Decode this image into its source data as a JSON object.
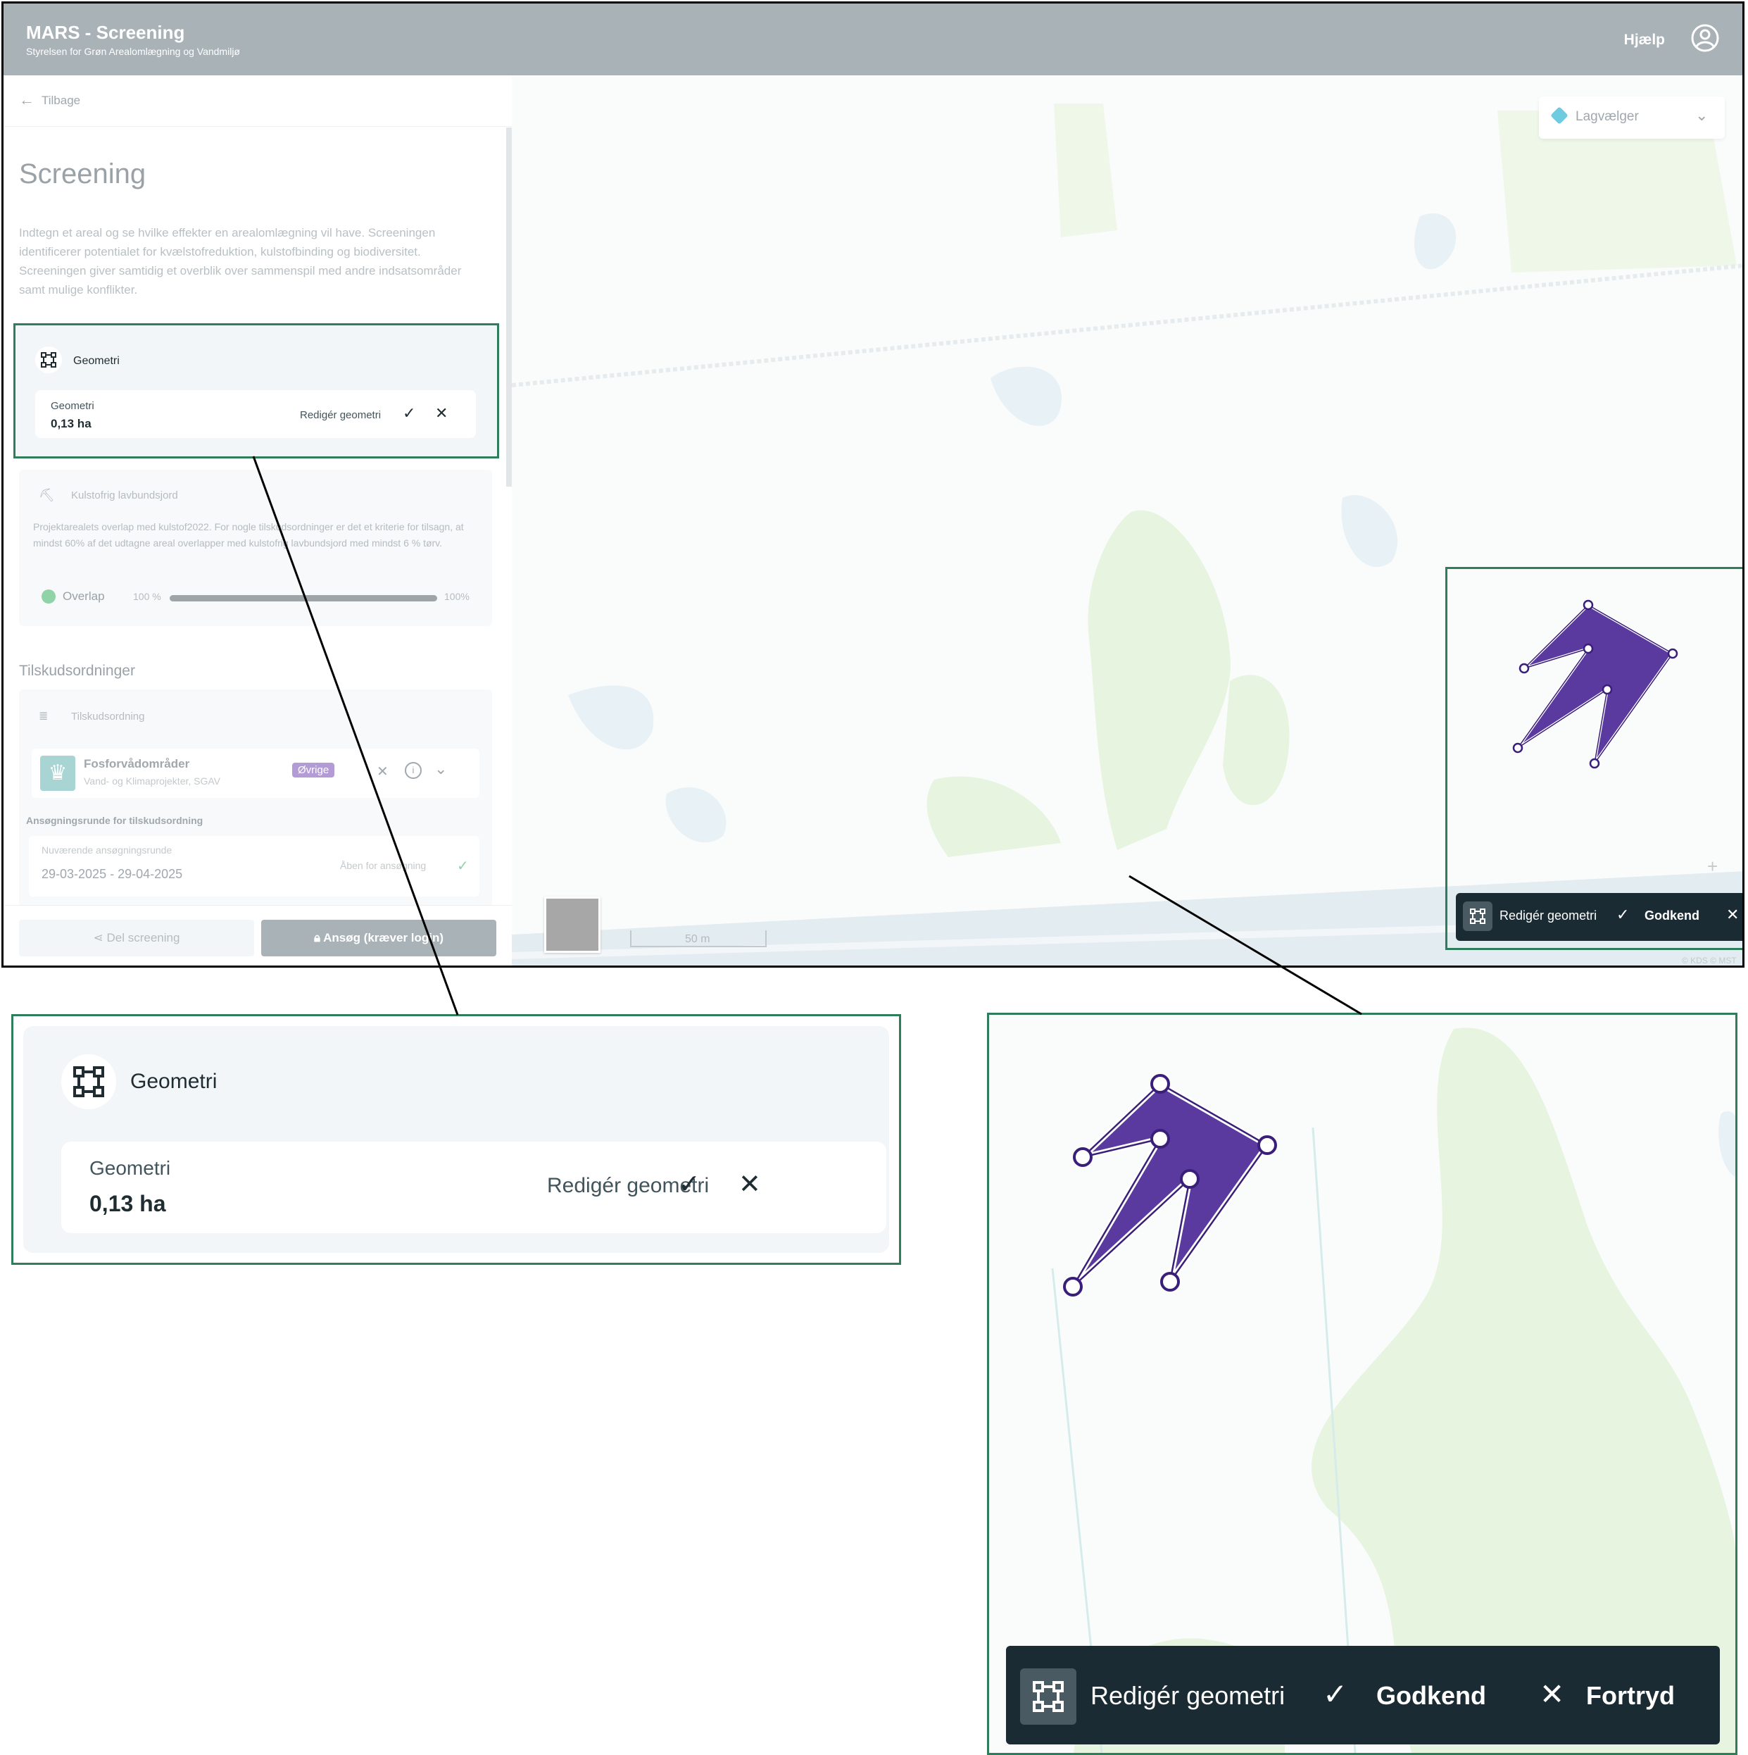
{
  "app": {
    "title": "MARS - Screening",
    "subtitle": "Styrelsen for Grøn Arealomlægning og Vandmiljø",
    "help": "Hjælp",
    "user_icon": "user-circle-icon"
  },
  "sidebar": {
    "back_label": "Tilbage",
    "title": "Screening",
    "intro": "Indtegn et areal og se hvilke effekter en arealomlægning vil have. Screeningen identificerer potentialet for kvælstofreduktion, kulstofbinding og biodiversitet. Screeningen giver samtidig et overblik over sammenspil med andre indsatsområder samt mulige konflikter.",
    "geometry_card": {
      "title": "Geometri",
      "label": "Geometri",
      "value": "0,13 ha",
      "edit_label": "Redigér geometri",
      "confirm_icon": "check-icon",
      "cancel_icon": "close-icon"
    },
    "kulstof_card": {
      "title": "Kulstofrig lavbundsjord",
      "text": "Projektarealets overlap med kulstof2022. For nogle tilskudsordninger er det et kriterie for tilsagn, at mindst 60% af det udtagne areal overlapper med kulstofrig lavbundsjord med mindst 6 % tørv.",
      "overlap_label": "Overlap",
      "overlap_value": "100 %",
      "overlap_max": "100%",
      "overlap_fraction": 1.0
    },
    "tilskud": {
      "heading": "Tilskudsordninger",
      "sub_title": "Tilskudsordning",
      "item": {
        "name": "Fosforvådområder",
        "org": "Vand- og Klimaprojekter, SGAV",
        "badge": "Øvrige"
      },
      "round_heading": "Ansøgningsrunde for tilskudsordning",
      "round_label": "Nuværende ansøgningsrunde",
      "round_dates": "29-03-2025 - 29-04-2025",
      "round_status": "Åben for ansøgning"
    },
    "footer": {
      "share_label": "Del screening",
      "apply_label": "Ansøg (kræver login)"
    }
  },
  "map": {
    "layer_label": "Lagvælger",
    "zoom_in": "+",
    "zoom_out": "−",
    "scale_label": "50 m",
    "copyright": "© KDS © MST",
    "polygon_color": "#5b3aa0",
    "toolbar": {
      "edit_label": "Redigér geometri",
      "confirm_label": "Godkend",
      "cancel_label": "Fortryd"
    }
  },
  "colors": {
    "accent_frame": "#2e7d5b",
    "toolbar_bg": "#1b2b33",
    "header_bg": "#a9b2b7"
  }
}
